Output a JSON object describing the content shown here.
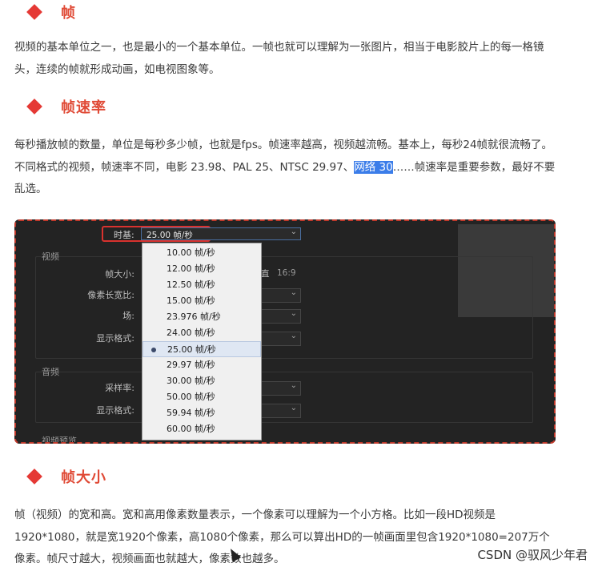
{
  "sections": [
    {
      "title": "帧",
      "paragraph": "视频的基本单位之一，也是最小的一个基本单位。一帧也就可以理解为一张图片，相当于电影胶片上的每一格镜头，连续的帧就形成动画，如电视图象等。"
    },
    {
      "title": "帧速率",
      "paragraph_before_highlight": "每秒播放帧的数量，单位是每秒多少帧，也就是fps。帧速率越高，视频越流畅。基本上，每秒24帧就很流畅了。不同格式的视频，帧速率不同，电影 23.98、PAL 25、NTSC 29.97、",
      "highlight": "网络 30",
      "paragraph_after_highlight": "……帧速率是重要参数，最好不要乱选。"
    },
    {
      "title": "帧大小",
      "paragraph": "帧（视频）的宽和高。宽和高用像素数量表示，一个像素可以理解为一个小方格。比如一段HD视频是1920*1080，就是宽1920个像素，高1080个像素，那么可以算出HD的一帧画面里包含1920*1080=207万个像素。帧尺寸越大，视频画面也就越大，像素数也越多。"
    }
  ],
  "settings_panel": {
    "timebase_label": "时基:",
    "timebase_value": "25.00  帧/秒",
    "video_group": "视频",
    "frame_size_label": "帧大小:",
    "pixel_aspect_label": "像素长宽比:",
    "field_label": "场:",
    "display_format_label": "显示格式:",
    "aspect_hint": "直",
    "aspect_value": "16:9",
    "audio_group": "音频",
    "sample_rate_label": "采样率:",
    "audio_display_format_label": "显示格式:",
    "preview_group": "视频预览",
    "options": [
      "10.00  帧/秒",
      "12.00  帧/秒",
      "12.50  帧/秒",
      "15.00  帧/秒",
      "23.976  帧/秒",
      "24.00  帧/秒",
      "25.00  帧/秒",
      "29.97  帧/秒",
      "30.00  帧/秒",
      "50.00  帧/秒",
      "59.94  帧/秒",
      "60.00  帧/秒"
    ],
    "selected_index": 6
  },
  "watermark": "CSDN @驭风少年君",
  "colors": {
    "heading": "#e04a36",
    "diamond": "#e53935",
    "highlight": "#3b7de9",
    "panel_border": "#c0392b"
  }
}
